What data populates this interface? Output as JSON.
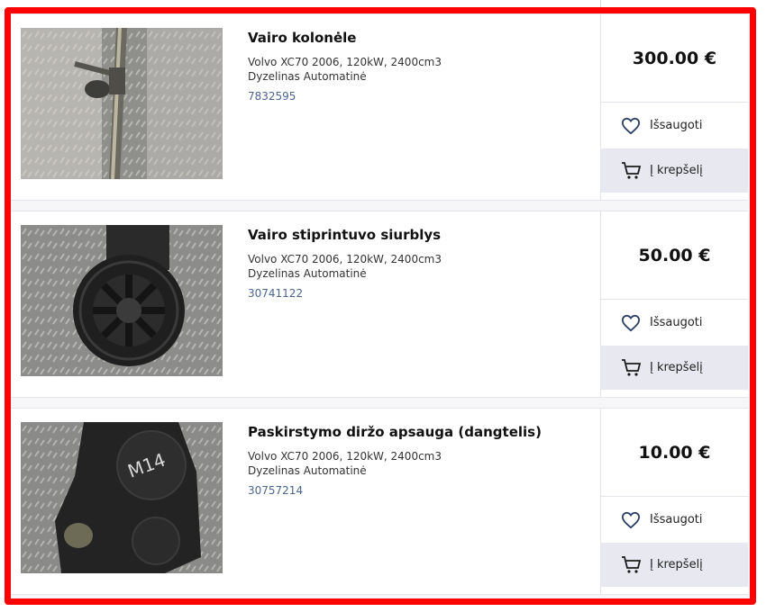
{
  "colors": {
    "frame_border": "#ff0000",
    "code_link": "#4a6590",
    "cart_bg": "#e8e8f1"
  },
  "listings": [
    {
      "image_icon": "steering-column-photo",
      "title": "Vairo kolonėle",
      "car": "Volvo XC70 2006, 120kW, 2400cm3",
      "fuel": "Dyzelinas Automatinė",
      "code": "7832595",
      "price": "300.00 €",
      "save_label": "Išsaugoti",
      "cart_label": "Į krepšelį"
    },
    {
      "image_icon": "power-steering-pump-photo",
      "title": "Vairo stiprintuvo siurblys",
      "car": "Volvo XC70 2006, 120kW, 2400cm3",
      "fuel": "Dyzelinas Automatinė",
      "code": "30741122",
      "price": "50.00 €",
      "save_label": "Išsaugoti",
      "cart_label": "Į krepšelį"
    },
    {
      "image_icon": "belt-cover-photo",
      "title": "Paskirstymo diržo apsauga (dangtelis)",
      "car": "Volvo XC70 2006, 120kW, 2400cm3",
      "fuel": "Dyzelinas Automatinė",
      "code": "30757214",
      "price": "10.00 €",
      "save_label": "Išsaugoti",
      "cart_label": "Į krepšelį"
    }
  ]
}
